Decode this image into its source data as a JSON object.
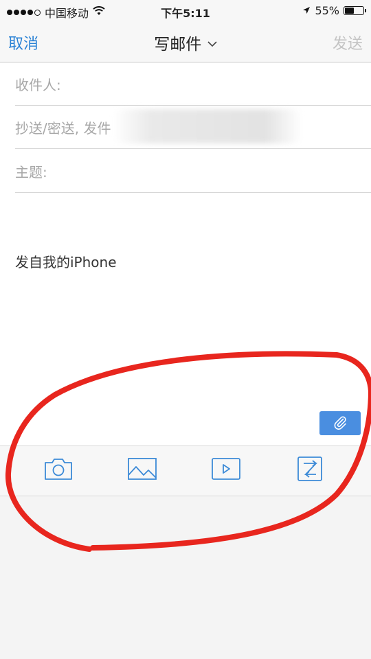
{
  "status_bar": {
    "carrier": "中国移动",
    "time": "下午5:11",
    "battery_percent": "55%",
    "battery_level": 0.55
  },
  "nav": {
    "cancel_label": "取消",
    "title": "写邮件",
    "send_label": "发送"
  },
  "form": {
    "to_label": "收件人:",
    "cc_label": "抄送/密送, 发件",
    "subject_label": "主题:",
    "signature": "发自我的iPhone"
  },
  "toolbar": {
    "icons": [
      "camera-icon",
      "photo-icon",
      "video-icon",
      "attachment-icon"
    ]
  },
  "colors": {
    "accent": "#2a82d5",
    "send_disabled": "#c3c3c3",
    "attach_button": "#4a8ee0",
    "annotation": "#e8261e"
  }
}
